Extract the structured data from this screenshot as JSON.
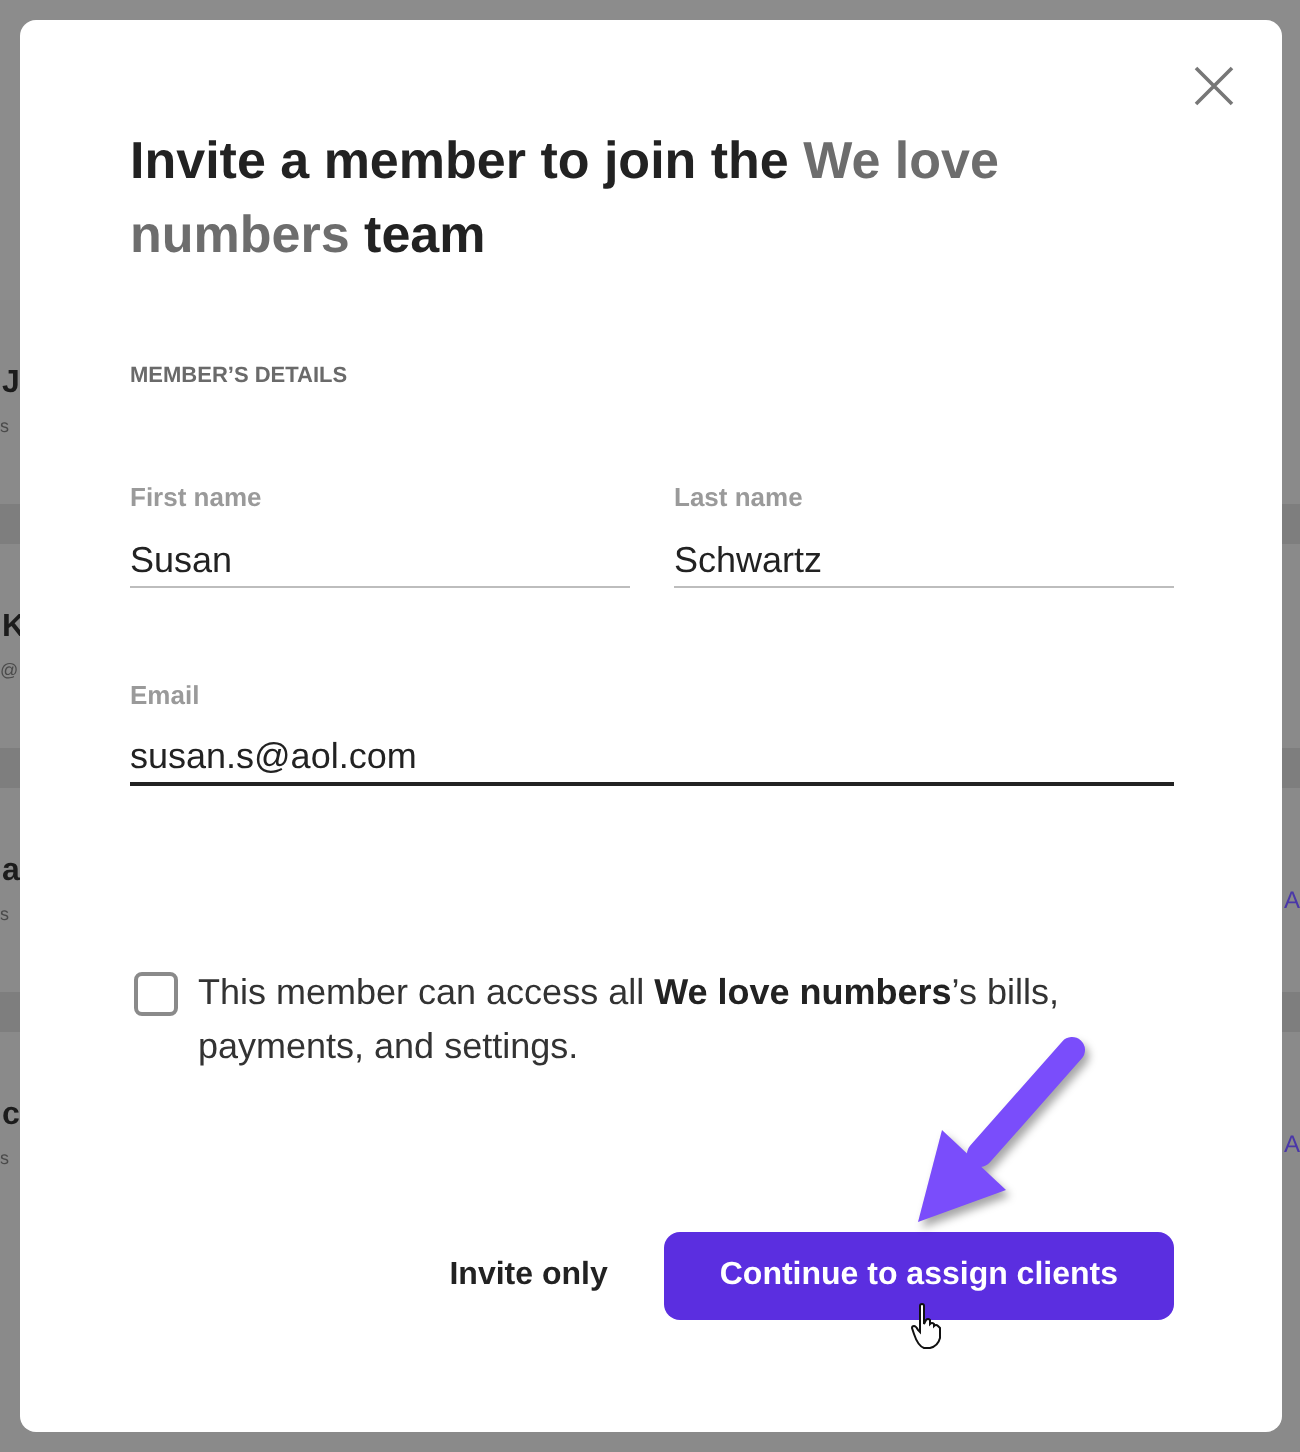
{
  "background_page": {
    "rows": [
      {
        "name": "J",
        "detail": "s"
      },
      {
        "name": "K",
        "detail": "@"
      },
      {
        "name": "a",
        "detail": "s",
        "action": "A"
      },
      {
        "name": "c",
        "detail": "s",
        "action": "A"
      }
    ]
  },
  "dialog": {
    "title": [
      {
        "text": "Invite a member to join the ",
        "kind": "plain"
      },
      {
        "text": "We love numbers",
        "kind": "team"
      },
      {
        "text": " team",
        "kind": "plain"
      }
    ],
    "section_label": "MEMBER’S DETAILS",
    "fields": [
      {
        "kind": "name",
        "label": "First name",
        "value": "Susan",
        "focused": false
      },
      {
        "kind": "name",
        "label": "Last name",
        "value": "Schwartz",
        "focused": false
      },
      {
        "kind": "email",
        "label": "Email",
        "value": "susan.s@aol.com",
        "focused": true
      }
    ],
    "consent": {
      "checked": false,
      "text": "This member can access all **We love numbers**’s bills, payments, and settings."
    },
    "buttons": [
      {
        "kind": "text",
        "label": "Invite only"
      },
      {
        "kind": "primary",
        "label": "Continue to assign clients"
      }
    ]
  }
}
